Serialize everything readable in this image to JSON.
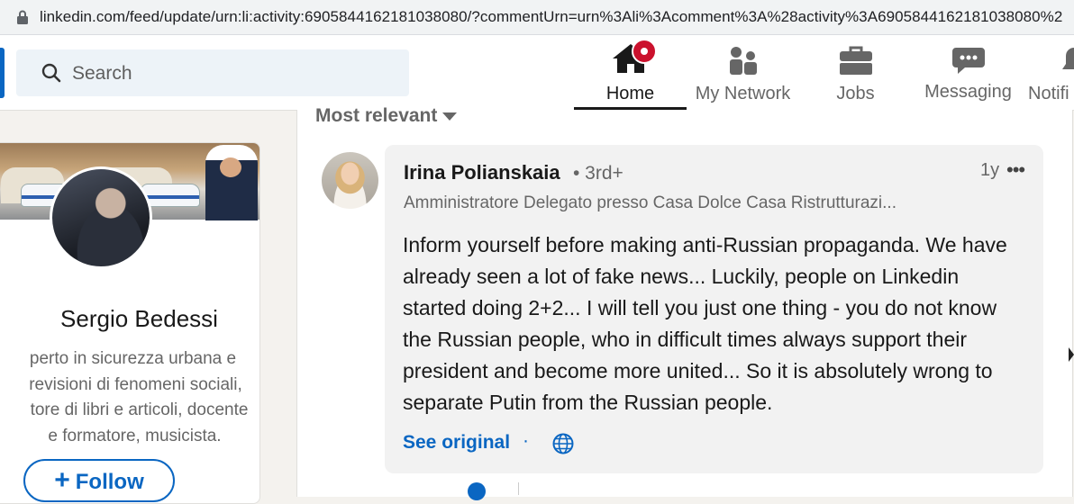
{
  "browser": {
    "url": "linkedin.com/feed/update/urn:li:activity:6905844162181038080/?commentUrn=urn%3Ali%3Acomment%3A%28activity%3A6905844162181038080%2"
  },
  "nav": {
    "search_placeholder": "Search",
    "items": [
      {
        "label": "Home",
        "icon": "home-icon",
        "active": true,
        "badge": true
      },
      {
        "label": "My Network",
        "icon": "network-icon"
      },
      {
        "label": "Jobs",
        "icon": "briefcase-icon"
      },
      {
        "label": "Messaging",
        "icon": "messaging-icon"
      },
      {
        "label": "Notifi",
        "icon": "bell-icon"
      }
    ],
    "active_color": "#191919",
    "badge_color": "#cb112d"
  },
  "profile": {
    "name": "Sergio Bedessi",
    "headline": [
      "perto in sicurezza urbana e",
      "revisioni di fenomeni sociali,",
      "tore di libri e articoli, docente",
      "e formatore, musicista."
    ],
    "follow_label": "Follow"
  },
  "feed": {
    "sort_label": "Most relevant",
    "comment": {
      "author": "Irina Polianskaia",
      "degree": "• 3rd+",
      "time": "1y",
      "more": "•••",
      "subtitle": "Amministratore Delegato presso Casa Dolce Casa Ristrutturazi...",
      "text": "Inform yourself before making anti-Russian propaganda. We have already seen a lot of fake news... Luckily, people on Linkedin started doing 2+2... I will tell you just one thing - you do not know the Russian people, who in difficult times always support their president and become more united... So it is absolutely wrong to separate Putin from the Russian people.",
      "see_original": "See original",
      "separator": "·"
    }
  },
  "colors": {
    "brand_blue": "#0a66c2",
    "page_bg": "#f4f2ee",
    "bubble_bg": "#f2f2f2"
  }
}
